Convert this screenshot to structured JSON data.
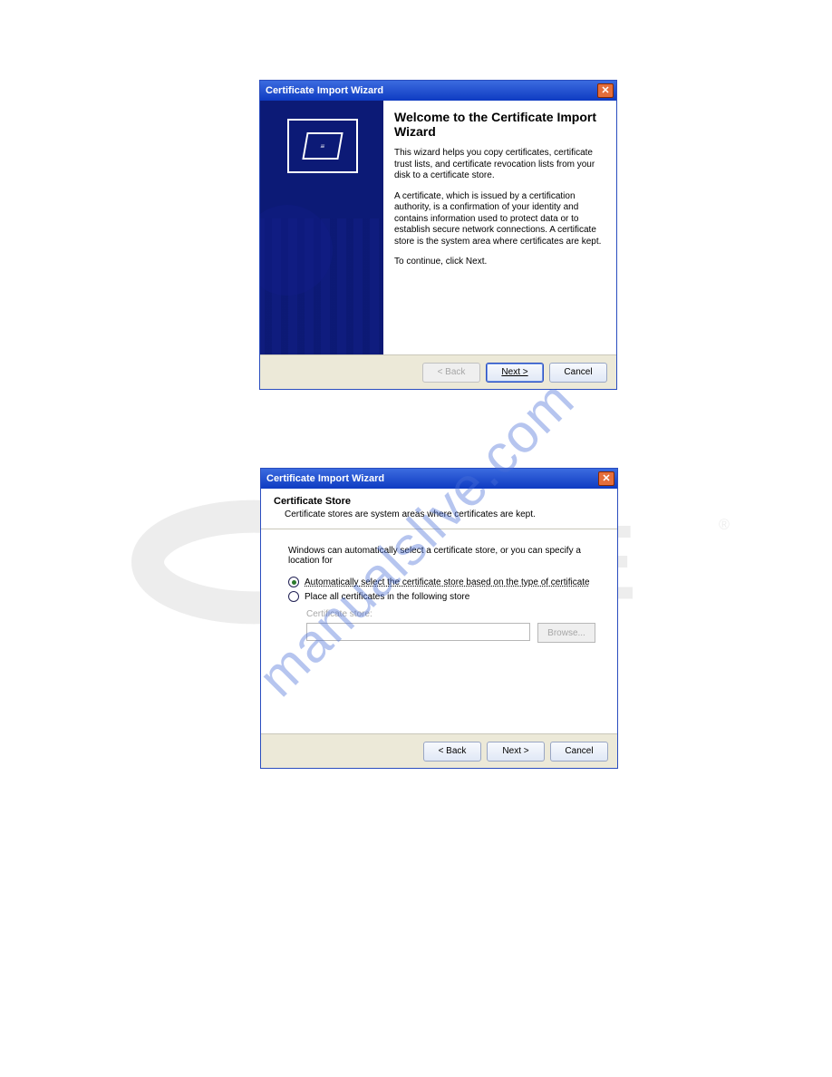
{
  "window1": {
    "title": "Certificate Import Wizard",
    "heading": "Welcome to the Certificate Import Wizard",
    "para1": "This wizard helps you copy certificates, certificate trust lists, and certificate revocation lists from your disk to a certificate store.",
    "para2": "A certificate, which is issued by a certification authority, is a confirmation of your identity and contains information used to protect data or to establish secure network connections. A certificate store is the system area where certificates are kept.",
    "para3": "To continue, click Next.",
    "footer": {
      "back": "< Back",
      "next": "Next >",
      "cancel": "Cancel"
    }
  },
  "window2": {
    "title": "Certificate Import Wizard",
    "step_title": "Certificate Store",
    "step_desc": "Certificate stores are system areas where certificates are kept.",
    "intro": "Windows can automatically select a certificate store, or you can specify a location for",
    "radio_auto": "Automatically select the certificate store based on the type of certificate",
    "radio_manual": "Place all certificates in the following store",
    "store_label": "Certificate store:",
    "store_value": "",
    "browse": "Browse...",
    "footer": {
      "back": "< Back",
      "next": "Next >",
      "cancel": "Cancel"
    }
  },
  "watermark": "manualslive.com"
}
